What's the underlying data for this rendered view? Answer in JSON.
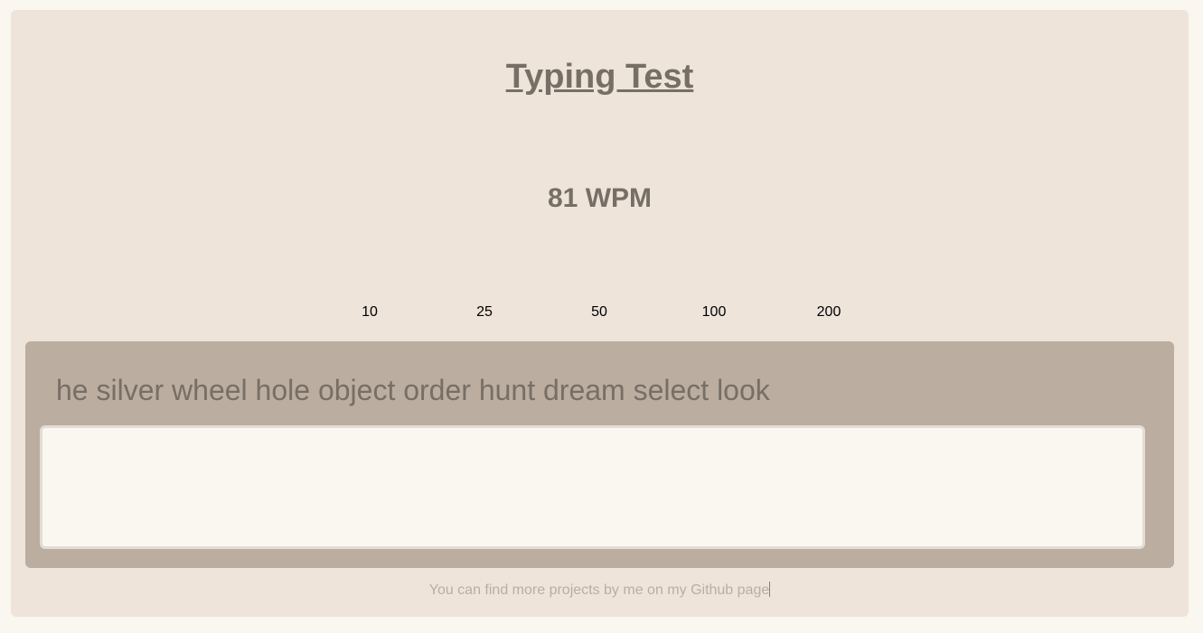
{
  "header": {
    "title": "Typing Test"
  },
  "stats": {
    "wpm_display": "81 WPM"
  },
  "word_count_options": [
    "10",
    "25",
    "50",
    "100",
    "200"
  ],
  "test": {
    "words_text": "he silver wheel hole object order hunt dream select look",
    "input_value": ""
  },
  "footer": {
    "prefix_text": "You can find more projects by me on my ",
    "link_text": "Github page"
  },
  "colors": {
    "page_background": "#f9f7ef",
    "card_background": "#eee4da",
    "panel_background": "#bbada0",
    "text_primary": "#776e65",
    "footer_text": "#b9aea3"
  }
}
